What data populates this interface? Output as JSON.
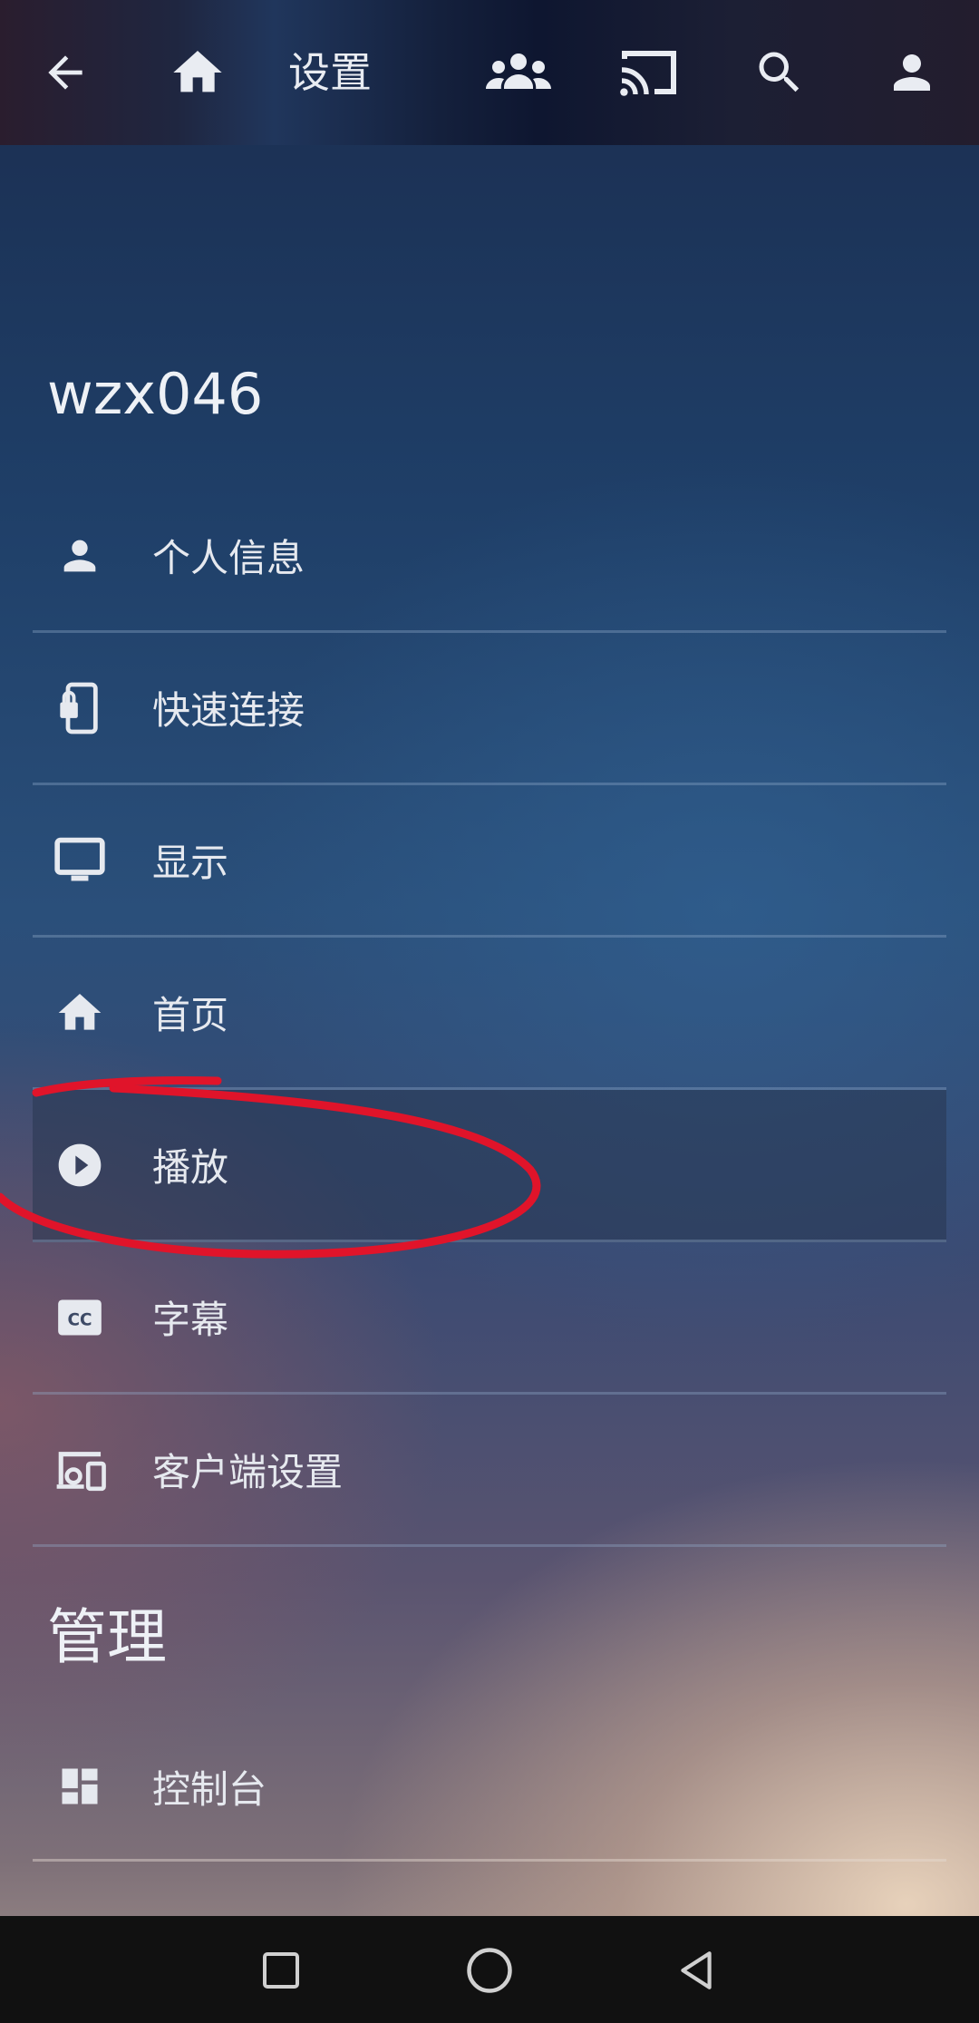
{
  "header": {
    "title": "设置",
    "icons": [
      "back-arrow-icon",
      "home-icon",
      "users-icon",
      "cast-icon",
      "search-icon",
      "user-icon"
    ]
  },
  "user": {
    "name": "wzx046"
  },
  "menu": {
    "items": [
      {
        "label": "个人信息",
        "icon": "person-icon"
      },
      {
        "label": "快速连接",
        "icon": "quick-connect-icon"
      },
      {
        "label": "显示",
        "icon": "monitor-icon"
      },
      {
        "label": "首页",
        "icon": "home-icon"
      },
      {
        "label": "播放",
        "icon": "play-circle-icon",
        "selected": true
      },
      {
        "label": "字幕",
        "icon": "closed-caption-icon"
      },
      {
        "label": "客户端设置",
        "icon": "devices-icon"
      }
    ]
  },
  "admin": {
    "title": "管理",
    "items": [
      {
        "label": "控制台",
        "icon": "dashboard-icon"
      }
    ]
  },
  "navbar": {
    "icons": [
      "recents-square-icon",
      "home-circle-icon",
      "back-triangle-icon"
    ]
  },
  "colors": {
    "annotation": "#e0142a",
    "text": "#e6e9ef"
  }
}
